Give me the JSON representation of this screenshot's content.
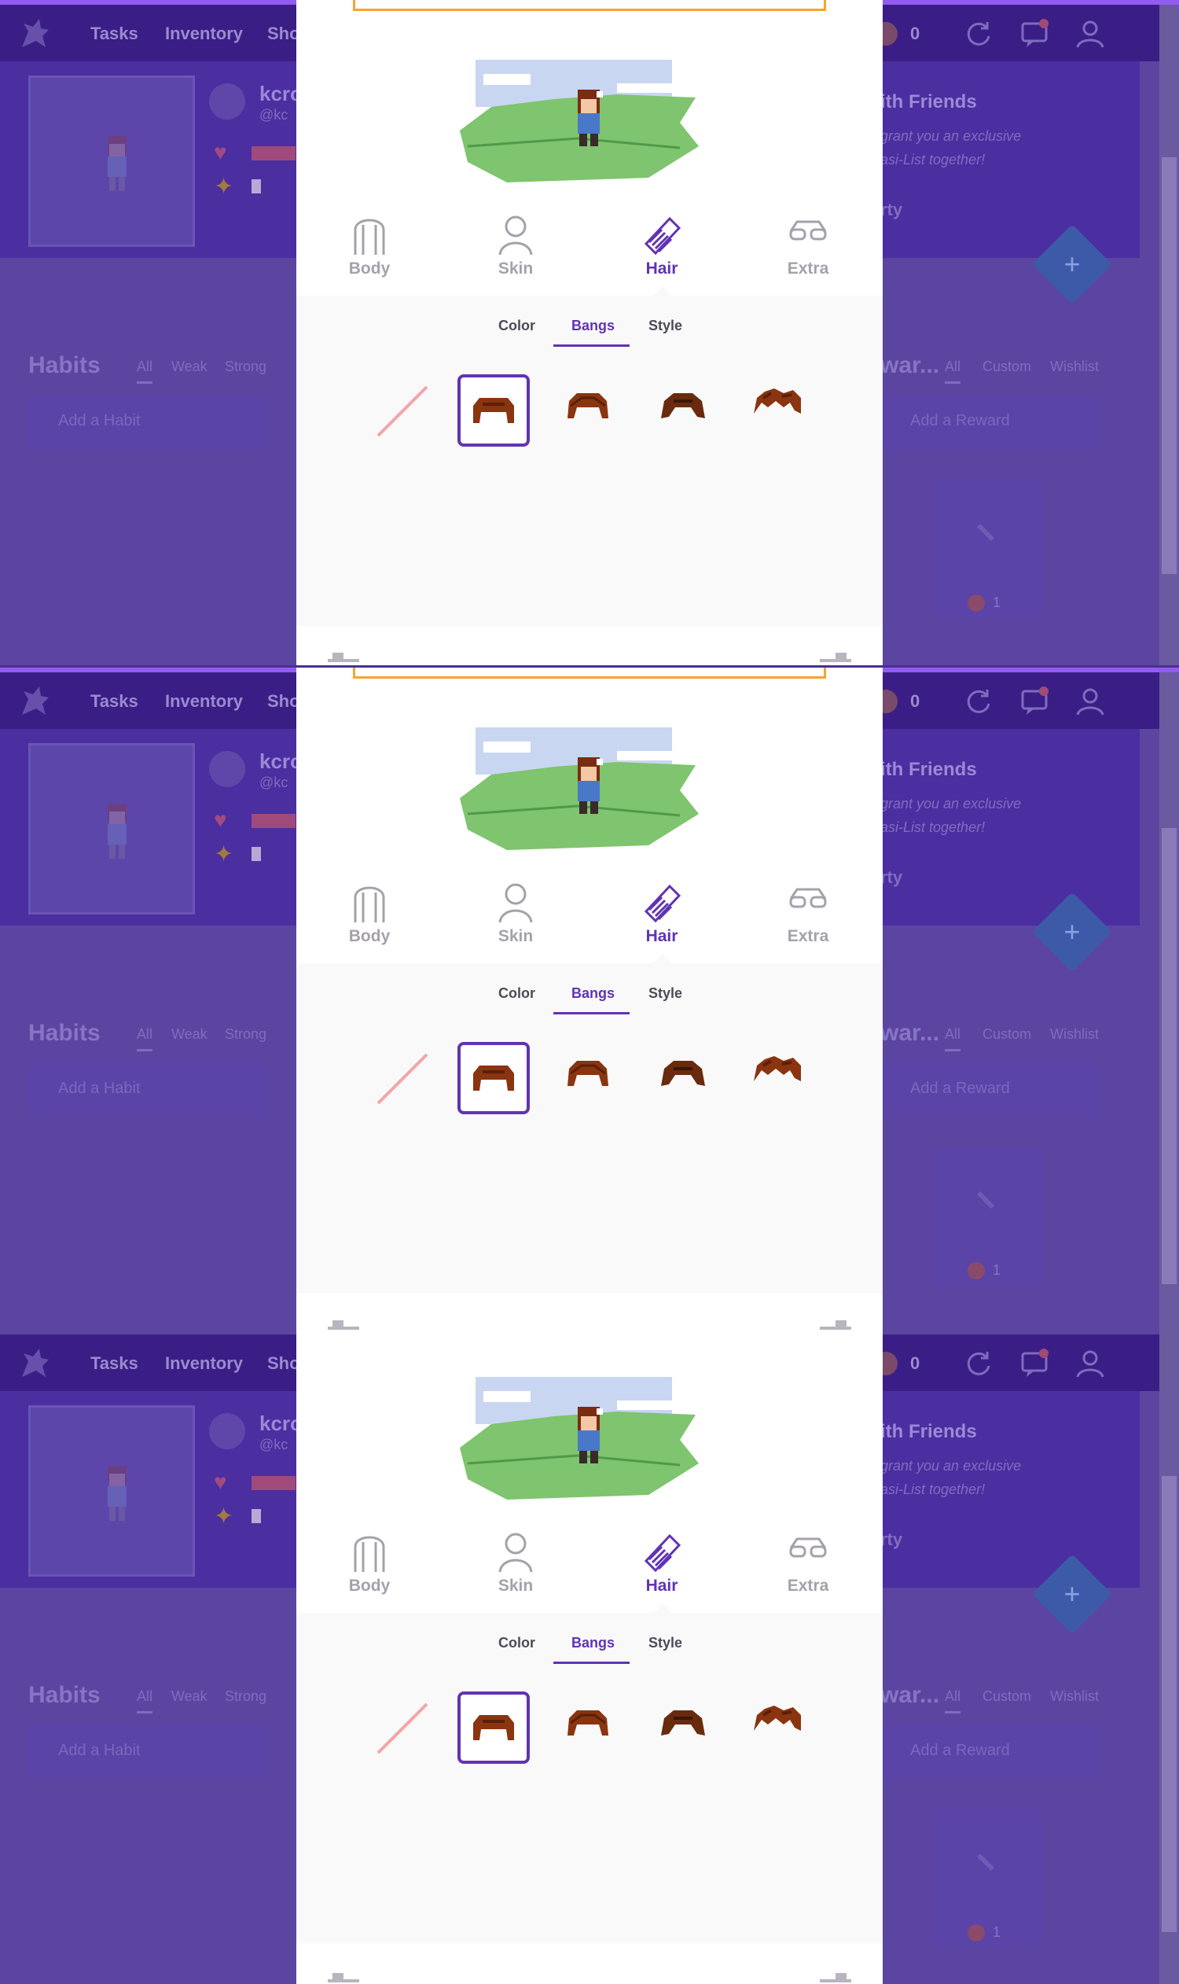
{
  "nav": {
    "links": [
      "Tasks",
      "Inventory",
      "Sho"
    ],
    "gem_count": "0"
  },
  "header": {
    "username": "kcro",
    "handle": "@kc",
    "friends_title": "ith Friends",
    "friends_line1": "grant you an exclusive",
    "friends_line2": "asi-List together!",
    "party_label": "rty"
  },
  "habits": {
    "title": "Habits",
    "filters": [
      "All",
      "Weak",
      "Strong"
    ],
    "add_placeholder": "Add a Habit"
  },
  "rewards": {
    "title": "war...",
    "filters": [
      "All",
      "Custom",
      "Wishlist"
    ],
    "add_placeholder": "Add a Reward",
    "card_value": "1"
  },
  "fab_label": "+",
  "modal": {
    "main_tabs": [
      {
        "label": "Body",
        "icon": "body-icon",
        "active": false
      },
      {
        "label": "Skin",
        "icon": "skin-icon",
        "active": false
      },
      {
        "label": "Hair",
        "icon": "comb-icon",
        "active": true
      },
      {
        "label": "Extra",
        "icon": "glasses-icon",
        "active": false
      }
    ],
    "sub_tabs": [
      {
        "label": "Color",
        "active": false
      },
      {
        "label": "Bangs",
        "active": true
      },
      {
        "label": "Style",
        "active": false
      }
    ],
    "bangs_options": [
      "none",
      "bangs-1",
      "bangs-2",
      "bangs-3",
      "bangs-4"
    ],
    "selected_option": "bangs-1"
  },
  "colors": {
    "accent": "#6133b4",
    "orange_border": "#f9a431",
    "hair": "#8a3410",
    "overlay_purple": "#4b2ea0"
  }
}
